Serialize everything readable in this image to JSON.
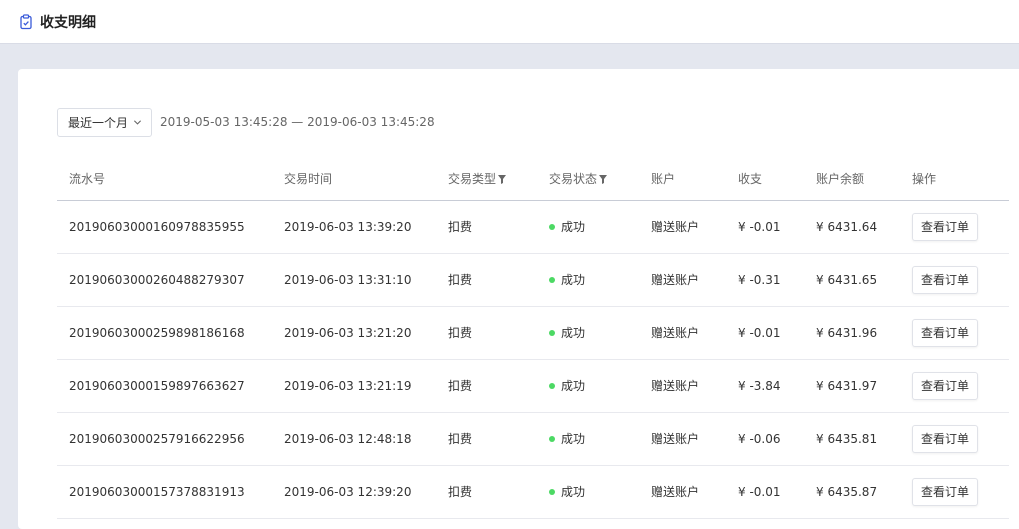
{
  "header": {
    "title": "收支明细",
    "icon": "clipboard-icon"
  },
  "filter": {
    "range_label": "最近一个月",
    "date_start": "2019-05-03 13:45:28",
    "date_sep": "—",
    "date_end": "2019-06-03 13:45:28"
  },
  "table": {
    "columns": [
      "流水号",
      "交易时间",
      "交易类型",
      "交易状态",
      "账户",
      "收支",
      "账户余额",
      "操作"
    ],
    "rows": [
      {
        "serial": "201906030001609788359​55",
        "time": "2019-06-03 13:39:20",
        "type": "扣费",
        "status": "成功",
        "account": "赠送账户",
        "amount": "¥ -0.01",
        "balance": "¥ 6431.64",
        "action": "查看订单"
      },
      {
        "serial": "20190603000260488279307",
        "time": "2019-06-03 13:31:10",
        "type": "扣费",
        "status": "成功",
        "account": "赠送账户",
        "amount": "¥ -0.31",
        "balance": "¥ 6431.65",
        "action": "查看订单"
      },
      {
        "serial": "20190603000259898186168",
        "time": "2019-06-03 13:21:20",
        "type": "扣费",
        "status": "成功",
        "account": "赠送账户",
        "amount": "¥ -0.01",
        "balance": "¥ 6431.96",
        "action": "查看订单"
      },
      {
        "serial": "20190603000159897663627",
        "time": "2019-06-03 13:21:19",
        "type": "扣费",
        "status": "成功",
        "account": "赠送账户",
        "amount": "¥ -3.84",
        "balance": "¥ 6431.97",
        "action": "查看订单"
      },
      {
        "serial": "20190603000257916622956",
        "time": "2019-06-03 12:48:18",
        "type": "扣费",
        "status": "成功",
        "account": "赠送账户",
        "amount": "¥ -0.06",
        "balance": "¥ 6435.81",
        "action": "查看订单"
      },
      {
        "serial": "20190603000157378831913",
        "time": "2019-06-03 12:39:20",
        "type": "扣费",
        "status": "成功",
        "account": "赠送账户",
        "amount": "¥ -0.01",
        "balance": "¥ 6435.87",
        "action": "查看订单"
      }
    ]
  },
  "colors": {
    "negative": "#f5222d",
    "success_dot": "#4cd964",
    "page_bg": "#e4e7ef"
  }
}
